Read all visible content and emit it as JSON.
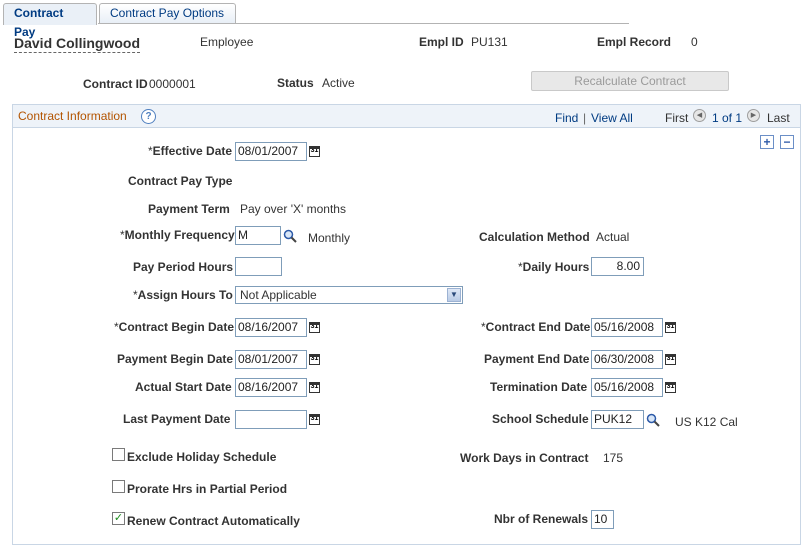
{
  "tabs": [
    {
      "label": "Contract Pay",
      "active": true
    },
    {
      "label": "Contract Pay Options",
      "active": false
    }
  ],
  "employee": {
    "name": "David Collingwood",
    "role": "Employee",
    "empl_id_label": "Empl ID",
    "empl_id": "PU131",
    "empl_record_label": "Empl Record",
    "empl_record": "0"
  },
  "contract": {
    "id_label": "Contract ID",
    "id": "0000001",
    "status_label": "Status",
    "status": "Active",
    "recalc_button": "Recalculate Contract"
  },
  "panel": {
    "title": "Contract Information",
    "find_link": "Find",
    "separator": "|",
    "view_all_link": "View All",
    "first_label": "First",
    "range": "1 of 1",
    "last_label": "Last"
  },
  "form": {
    "required_marker": "*",
    "effective_date_label": "Effective Date",
    "effective_date": "08/01/2007",
    "contract_pay_type_label": "Contract Pay Type",
    "payment_term_label": "Payment Term",
    "payment_term": "Pay over 'X' months",
    "monthly_frequency_label": "Monthly Frequency",
    "monthly_frequency": "M",
    "monthly_frequency_desc": "Monthly",
    "calculation_method_label": "Calculation Method",
    "calculation_method": "Actual",
    "pay_period_hours_label": "Pay Period Hours",
    "pay_period_hours": "",
    "daily_hours_label": "Daily Hours",
    "daily_hours": "8.00",
    "assign_hours_to_label": "Assign Hours To",
    "assign_hours_to": "Not Applicable",
    "contract_begin_date_label": "Contract Begin Date",
    "contract_begin_date": "08/16/2007",
    "contract_end_date_label": "Contract End Date",
    "contract_end_date": "05/16/2008",
    "payment_begin_date_label": "Payment Begin Date",
    "payment_begin_date": "08/01/2007",
    "payment_end_date_label": "Payment End Date",
    "payment_end_date": "06/30/2008",
    "actual_start_date_label": "Actual Start Date",
    "actual_start_date": "08/16/2007",
    "termination_date_label": "Termination Date",
    "termination_date": "05/16/2008",
    "last_payment_date_label": "Last Payment Date",
    "last_payment_date": "",
    "school_schedule_label": "School Schedule",
    "school_schedule": "PUK12",
    "school_schedule_desc": "US K12 Cal",
    "exclude_holiday_label": "Exclude Holiday Schedule",
    "exclude_holiday_checked": false,
    "work_days_label": "Work Days in Contract",
    "work_days": "175",
    "prorate_label": "Prorate Hrs in Partial Period",
    "prorate_checked": false,
    "renew_label": "Renew Contract Automatically",
    "renew_checked": true,
    "nbr_renewals_label": "Nbr of Renewals",
    "nbr_renewals": "10",
    "calendar_icon_text": "31",
    "check_mark": "✓",
    "add_symbol": "+",
    "remove_symbol": "−"
  },
  "colors": {
    "link": "#003b82",
    "panel_title": "#b35400",
    "panel_border": "#c9d6e5"
  }
}
